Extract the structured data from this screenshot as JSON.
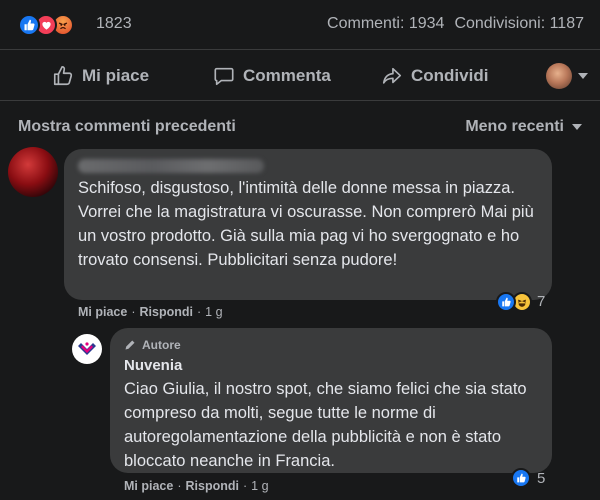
{
  "stats": {
    "reaction_count": "1823",
    "comments": "Commenti: 1934",
    "shares": "Condivisioni: 1187"
  },
  "actions": {
    "like": "Mi piace",
    "comment": "Commenta",
    "share": "Condividi"
  },
  "comments_header": {
    "more": "Mostra commenti precedenti",
    "sort": "Meno recenti"
  },
  "comment1": {
    "text": "Schifoso, disgustoso, l'intimità delle donne messa in piazza. Vorrei che la magistratura vi oscurasse. Non comprerò Mai più un vostro prodotto. Già sulla mia pag vi ho svergognato e ho trovato consensi. Pubblicitari senza pudore!",
    "reaction_count": "7",
    "like": "Mi piace",
    "reply": "Rispondi",
    "time": "1 g"
  },
  "comment2": {
    "badge": "Autore",
    "name": "Nuvenia",
    "text": "Ciao Giulia, il nostro spot, che siamo felici che sia stato compreso da molti, segue tutte le norme di autoregolamentazione della pubblicità e non è stato bloccato neanche in Francia.",
    "reaction_count": "5",
    "like": "Mi piace",
    "reply": "Rispondi",
    "time": "1 g"
  },
  "colors": {
    "background": "#18191a",
    "bubble": "#3a3b3c",
    "like_blue": "#1877f2",
    "love_red": "#f33e58",
    "angry_orange": "#f7714b"
  }
}
